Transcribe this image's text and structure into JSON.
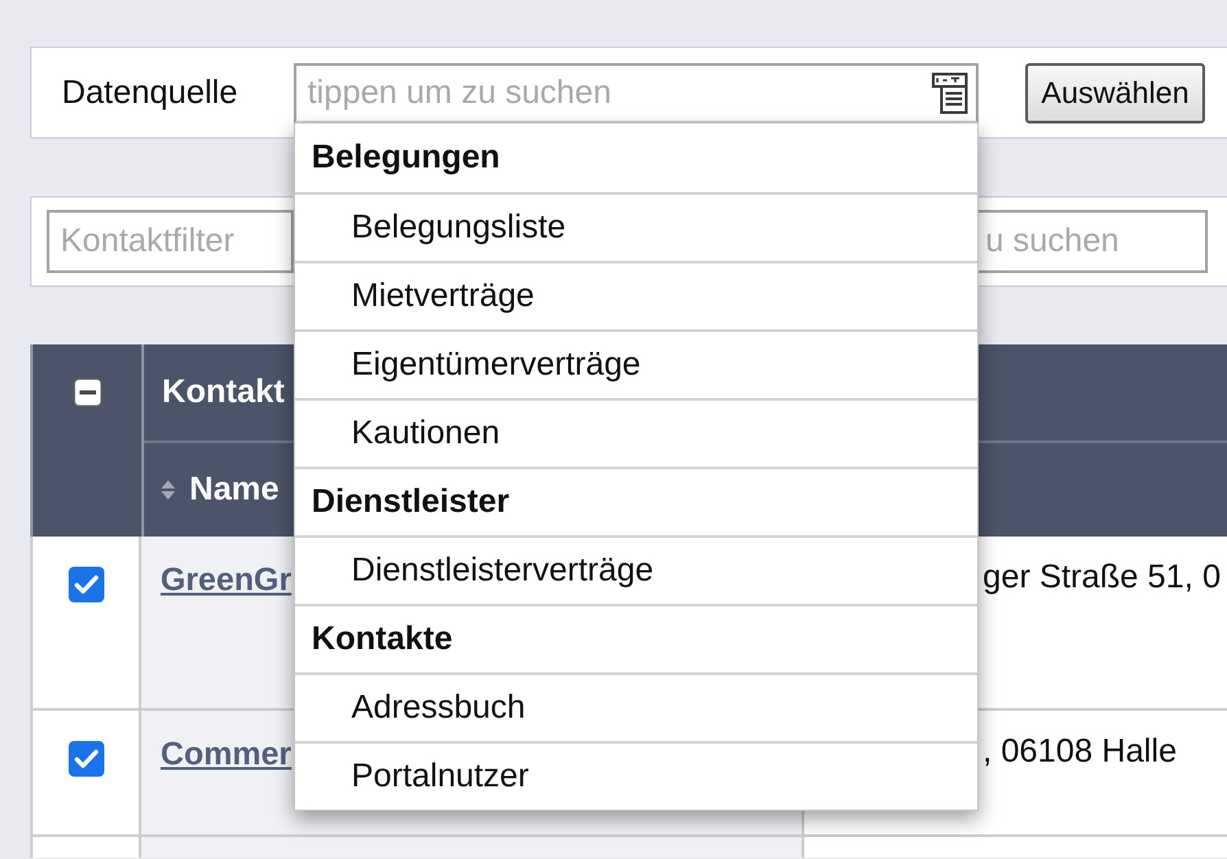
{
  "data_source": {
    "label": "Datenquelle",
    "search": {
      "placeholder": "tippen um zu suchen"
    },
    "button": "Auswählen",
    "dropdown": {
      "groups": [
        {
          "title": "Belegungen",
          "items": [
            "Belegungsliste",
            "Mietverträge",
            "Eigentümerverträge",
            "Kautionen"
          ]
        },
        {
          "title": "Dienstleister",
          "items": [
            "Dienstleisterverträge"
          ]
        },
        {
          "title": "Kontakte",
          "items": [
            "Adressbuch",
            "Portalnutzer"
          ]
        }
      ]
    }
  },
  "filters": {
    "contact_filter": {
      "placeholder": "Kontaktfilter"
    },
    "search": {
      "placeholder": "u suchen"
    }
  },
  "table": {
    "select_all": {
      "indeterminate": true
    },
    "group_header": "Kontakt",
    "columns": [
      {
        "label": "Name"
      }
    ],
    "rows": [
      {
        "checked": true,
        "name": "GreenGr",
        "column_3": "ger Straße 51, 0"
      },
      {
        "checked": true,
        "name": "Commer",
        "column_3": ", 06108 Halle"
      }
    ]
  }
}
